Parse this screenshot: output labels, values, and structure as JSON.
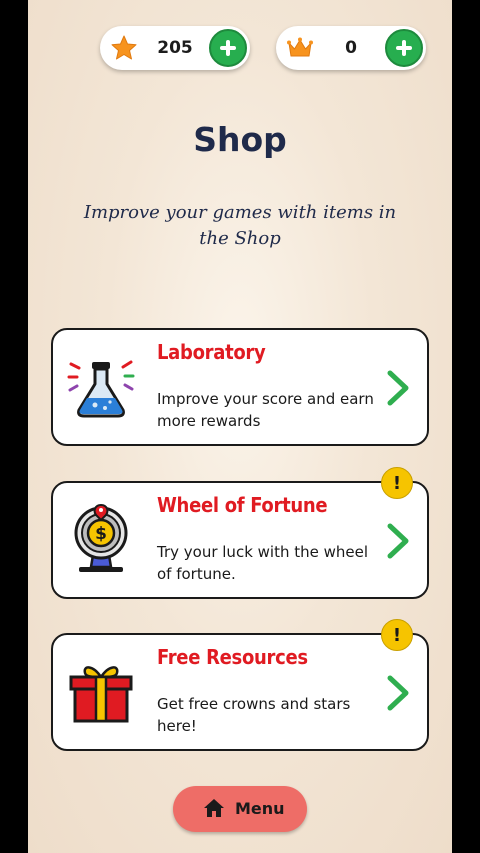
{
  "header": {
    "stars": {
      "value": "205",
      "icon": "star-icon",
      "color": "#f7931e"
    },
    "crowns": {
      "value": "0",
      "icon": "crown-icon",
      "color": "#f7931e"
    },
    "add_icon": "plus-icon",
    "add_color": "#27ae4f"
  },
  "page": {
    "title": "Shop",
    "subtitle": "Improve your games with items in the Shop"
  },
  "shop_items": [
    {
      "title": "Laboratory",
      "description": "Improve your score and earn more rewards",
      "icon": "flask-icon",
      "badge": ""
    },
    {
      "title": "Wheel of Fortune",
      "description": "Try your luck with the wheel of fortune.",
      "icon": "wheel-of-fortune-icon",
      "badge": "!"
    },
    {
      "title": "Free Resources",
      "description": "Get free crowns and stars here!",
      "icon": "gift-icon",
      "badge": "!"
    }
  ],
  "menu_button": {
    "label": "Menu",
    "icon": "home-icon",
    "color": "#ee6d67"
  },
  "colors": {
    "item_title": "#e01b22",
    "chevron": "#2fae4f",
    "badge": "#f6c400"
  }
}
